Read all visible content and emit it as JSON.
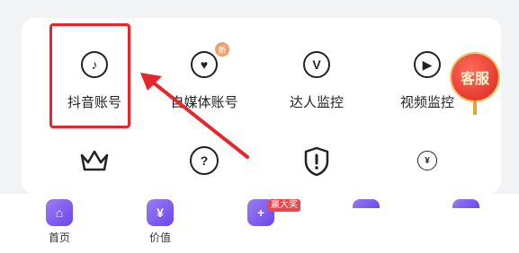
{
  "grid": {
    "items": [
      {
        "label": "抖音账号",
        "icon": "music-note-icon"
      },
      {
        "label": "自媒体账号",
        "icon": "heart-tag-icon",
        "badge": "新"
      },
      {
        "label": "达人监控",
        "icon": "v-letter-icon"
      },
      {
        "label": "视频监控",
        "icon": "play-icon"
      }
    ],
    "row2_icons": [
      "crown-icon",
      "question-icon",
      "shield-alert-icon",
      "yen-coin-icon"
    ]
  },
  "floating": {
    "kefu_label": "客服"
  },
  "tabbar": {
    "tabs": [
      {
        "label": "首页",
        "icon": "home-icon"
      },
      {
        "label": "价值",
        "icon": "yen-icon"
      },
      {
        "label": "",
        "icon": "plus-icon",
        "badge": "赢大奖"
      }
    ]
  },
  "colors": {
    "highlight": "#e5272d",
    "tab_purple": "#6b47e8",
    "badge_red": "#e5484d"
  }
}
